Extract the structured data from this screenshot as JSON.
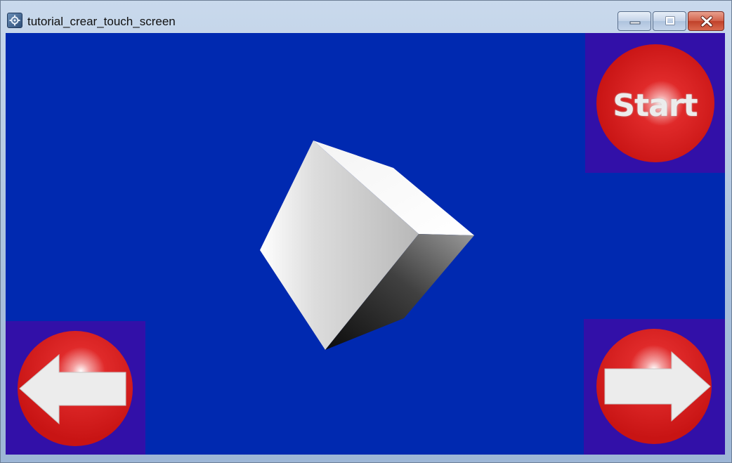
{
  "window": {
    "title": "tutorial_crear_touch_screen",
    "icon": "app-gear-icon",
    "controls": [
      "minimize-icon",
      "maximize-icon",
      "close-icon"
    ]
  },
  "scene": {
    "background_color": "#0029b0",
    "object": "cube",
    "object_color": "#d8d8d8"
  },
  "touch_controls": {
    "panel_color": "#3210a8",
    "button_color": "#d41e1e",
    "start": {
      "label": "Start",
      "icon": "start-circle-icon"
    },
    "left": {
      "icon": "arrow-left-icon"
    },
    "right": {
      "icon": "arrow-right-icon"
    }
  }
}
